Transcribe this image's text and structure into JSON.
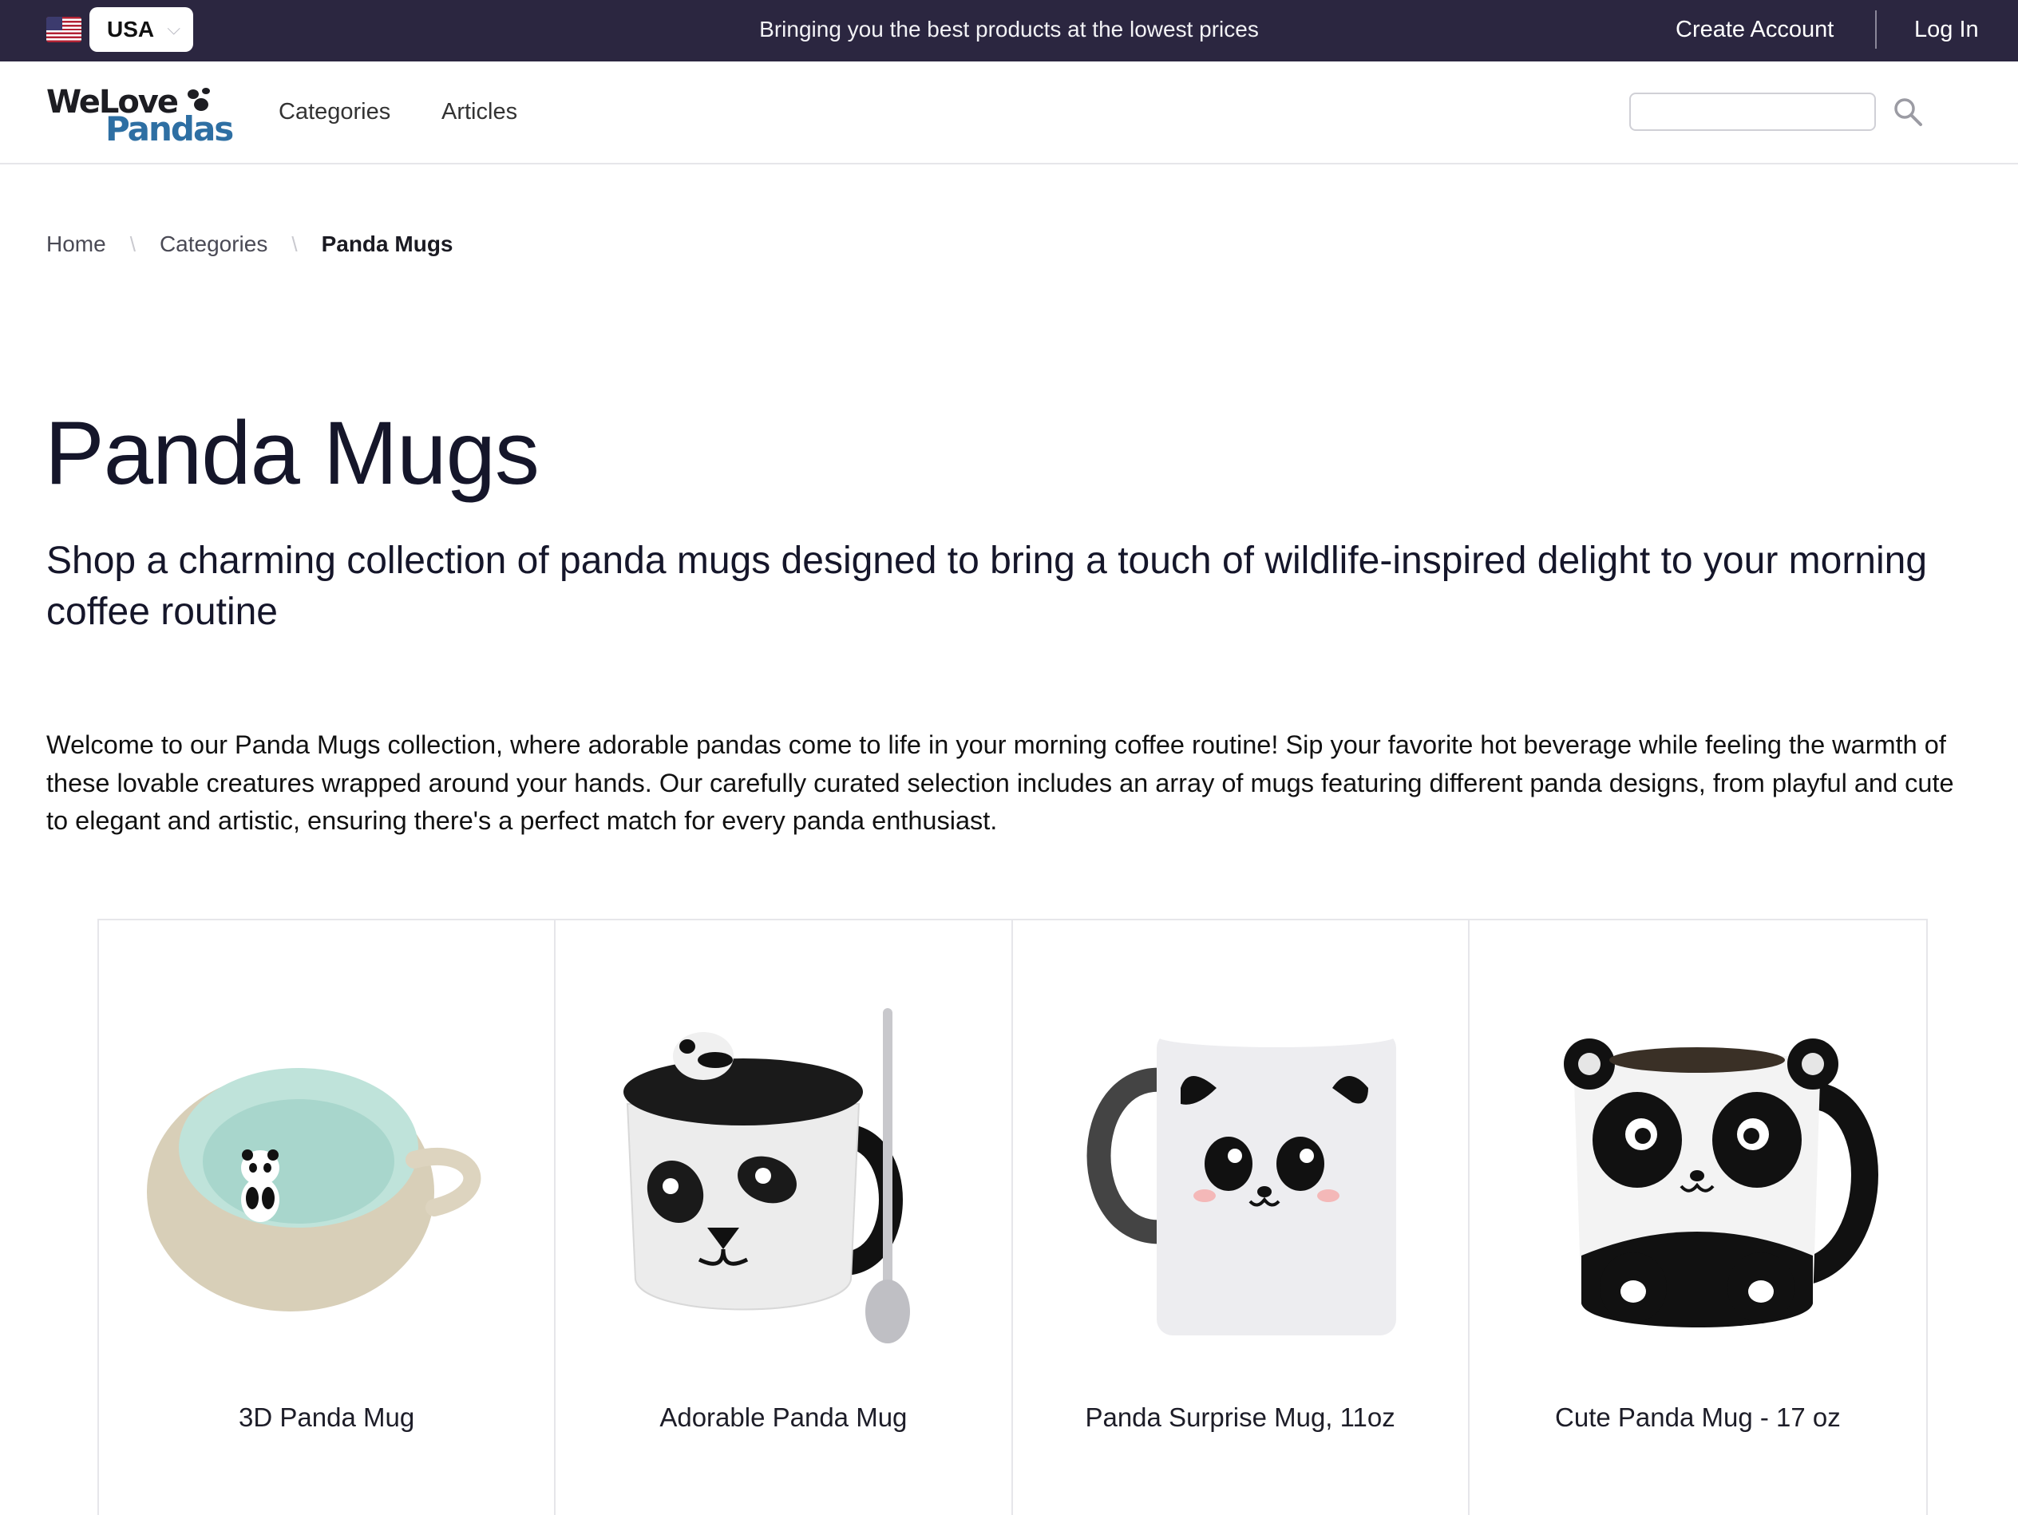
{
  "topbar": {
    "country": "USA",
    "promo": "Bringing you the best products at the lowest prices",
    "create_account": "Create Account",
    "log_in": "Log In"
  },
  "header": {
    "logo_line1": "WeLove",
    "logo_line2": "Pandas",
    "nav": [
      "Categories",
      "Articles"
    ],
    "search_placeholder": ""
  },
  "breadcrumb": [
    "Home",
    "Categories",
    "Panda Mugs"
  ],
  "page": {
    "title": "Panda Mugs",
    "subtitle": "Shop a charming collection of panda mugs designed to bring a touch of wildlife-inspired delight to your morning coffee routine",
    "description": "Welcome to our Panda Mugs collection, where adorable pandas come to life in your morning coffee routine! Sip your favorite hot beverage while feeling the warmth of these lovable creatures wrapped around your hands. Our carefully curated selection includes an array of mugs featuring different panda designs, from playful and cute to elegant and artistic, ensuring there's a perfect match for every panda enthusiast."
  },
  "products": [
    {
      "name": "3D Panda Mug",
      "image": "panda-figure-in-mint-cup"
    },
    {
      "name": "Adorable Panda Mug",
      "image": "panda-face-mug-with-lid-and-spoon"
    },
    {
      "name": "Panda Surprise Mug, 11oz",
      "image": "color-changing-panda-face-mug"
    },
    {
      "name": "Cute Panda Mug - 17 oz",
      "image": "panda-shaped-mug"
    }
  ],
  "colors": {
    "topbar_bg": "#2b2640",
    "logo_blue": "#2e6fa3",
    "title_text": "#15162a"
  }
}
